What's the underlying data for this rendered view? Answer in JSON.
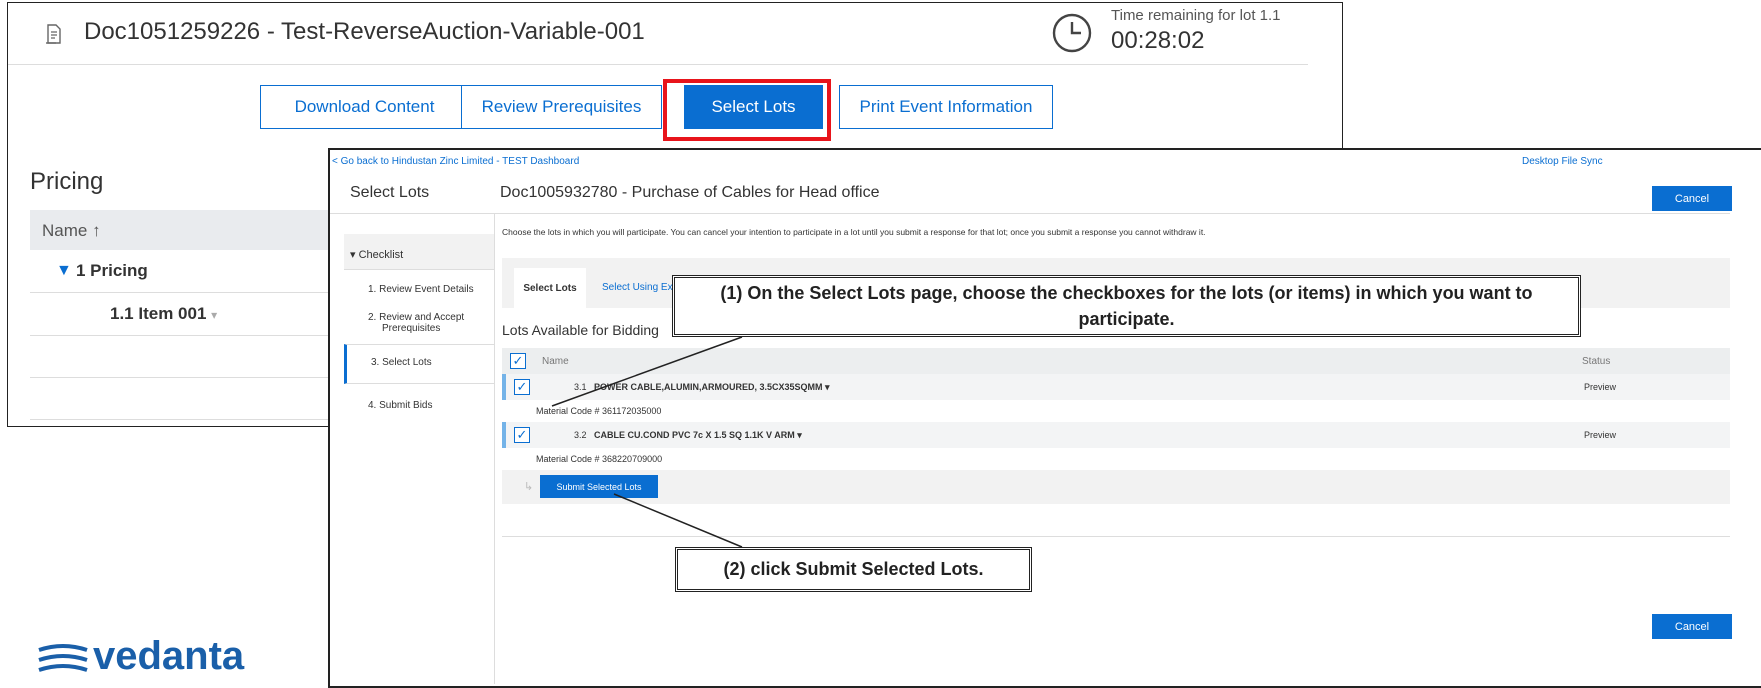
{
  "back_window": {
    "title": "Doc1051259226 - Test-ReverseAuction-Variable-001",
    "timer_label": "Time remaining for lot 1.1",
    "timer_value": "00:28:02",
    "buttons": {
      "download": "Download Content",
      "prerequisites": "Review Prerequisites",
      "select_lots": "Select Lots",
      "print": "Print Event Information"
    },
    "pricing_heading": "Pricing",
    "name_header": "Name ↑",
    "pricing_row": {
      "caret": "▼",
      "label": "1  Pricing"
    },
    "item_row": {
      "label": "1.1  Item 001",
      "caret": "▾"
    }
  },
  "front_window": {
    "back_link": "< Go back to Hindustan Zinc Limited - TEST Dashboard",
    "desktop_sync": "Desktop File Sync",
    "page_title": "Select Lots",
    "doc_title": "Doc1005932780 - Purchase of Cables for Head office",
    "cancel_label": "Cancel",
    "checklist": {
      "heading": "▾ Checklist",
      "items": [
        "1.  Review Event Details",
        "2.  Review and Accept Prerequisites",
        "3.  Select Lots",
        "4.  Submit Bids"
      ]
    },
    "intro_text": "Choose the lots in which you will participate.  You can cancel your intention to participate in a lot until you submit a response for that lot;  once you submit a response you cannot withdraw it.",
    "tabs": {
      "select_lots": "Select Lots",
      "select_excel": "Select Using Excel"
    },
    "lots_title": "Lots Available for Bidding",
    "columns": {
      "name": "Name",
      "status": "Status"
    },
    "checkmark": "✓",
    "lots": [
      {
        "number": "3.1",
        "name": "POWER CABLE,ALUMIN,ARMOURED, 3.5CX35SQMM ▾",
        "material_code": "Material Code # 361172035000",
        "status": "Preview"
      },
      {
        "number": "3.2",
        "name": "CABLE CU.COND PVC 7c X 1.5 SQ 1.1K V ARM ▾",
        "material_code": "Material Code # 368220709000",
        "status": "Preview"
      }
    ],
    "submit_arrow": "↳",
    "submit_label": "Submit Selected Lots"
  },
  "callouts": {
    "step1": "(1) On the Select Lots page, choose the checkboxes for the lots (or items) in which you want to participate.",
    "step2": "(2) click Submit Selected Lots."
  },
  "logo": {
    "text": "vedanta"
  },
  "colors": {
    "accent_blue": "#0a6ed1",
    "highlight_red": "#e8141b",
    "logo_blue": "#1a5fa9"
  }
}
